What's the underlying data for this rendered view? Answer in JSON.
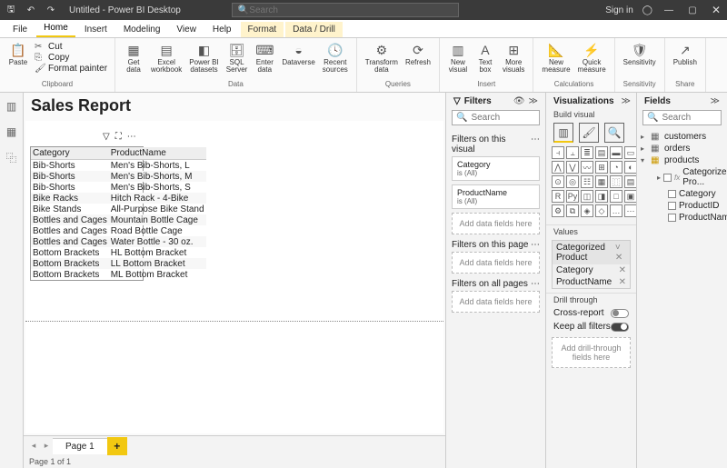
{
  "titlebar": {
    "title": "Untitled - Power BI Desktop",
    "search_placeholder": "Search",
    "signin": "Sign in"
  },
  "tabs": {
    "file": "File",
    "home": "Home",
    "insert": "Insert",
    "modeling": "Modeling",
    "view": "View",
    "help": "Help",
    "format": "Format",
    "data_drill": "Data / Drill"
  },
  "ribbon": {
    "clipboard": {
      "label": "Clipboard",
      "paste": "Paste",
      "cut": "Cut",
      "copy": "Copy",
      "format_painter": "Format painter"
    },
    "data": {
      "label": "Data",
      "get_data": "Get\ndata",
      "excel": "Excel\nworkbook",
      "pbi": "Power BI\ndatasets",
      "sql": "SQL\nServer",
      "enter": "Enter\ndata",
      "dataverse": "Dataverse",
      "recent": "Recent\nsources"
    },
    "queries": {
      "label": "Queries",
      "transform": "Transform\ndata",
      "refresh": "Refresh"
    },
    "insert": {
      "label": "Insert",
      "new_visual": "New\nvisual",
      "text_box": "Text\nbox",
      "more": "More\nvisuals"
    },
    "calc": {
      "label": "Calculations",
      "new_measure": "New\nmeasure",
      "quick_measure": "Quick\nmeasure"
    },
    "sens": {
      "label": "Sensitivity",
      "btn": "Sensitivity"
    },
    "share": {
      "label": "Share",
      "publish": "Publish"
    }
  },
  "report": {
    "title": "Sales Report"
  },
  "table": {
    "col1": "Category",
    "col2": "ProductName",
    "rows": [
      [
        "Bib-Shorts",
        "Men's Bib-Shorts, L"
      ],
      [
        "Bib-Shorts",
        "Men's Bib-Shorts, M"
      ],
      [
        "Bib-Shorts",
        "Men's Bib-Shorts, S"
      ],
      [
        "Bike Racks",
        "Hitch Rack - 4-Bike"
      ],
      [
        "Bike Stands",
        "All-Purpose Bike Stand"
      ],
      [
        "Bottles and Cages",
        "Mountain Bottle Cage"
      ],
      [
        "Bottles and Cages",
        "Road Bottle Cage"
      ],
      [
        "Bottles and Cages",
        "Water Bottle - 30 oz."
      ],
      [
        "Bottom Brackets",
        "HL Bottom Bracket"
      ],
      [
        "Bottom Brackets",
        "LL Bottom Bracket"
      ],
      [
        "Bottom Brackets",
        "ML Bottom Bracket"
      ]
    ]
  },
  "page": {
    "tab": "Page 1",
    "status": "Page 1 of 1"
  },
  "filters": {
    "title": "Filters",
    "search": "Search",
    "on_visual": "Filters on this visual",
    "category": "Category",
    "cat_val": "is (All)",
    "product": "ProductName",
    "prod_val": "is (All)",
    "add_here": "Add data fields here",
    "on_page": "Filters on this page",
    "on_all": "Filters on all pages"
  },
  "viz": {
    "title": "Visualizations",
    "build": "Build visual",
    "values": "Values",
    "catprod": "Categorized Product",
    "category": "Category",
    "product": "ProductName",
    "drill": "Drill through",
    "cross": "Cross-report",
    "keep": "Keep all filters",
    "add_drill": "Add drill-through fields here"
  },
  "fields": {
    "title": "Fields",
    "search": "Search",
    "customers": "customers",
    "orders": "orders",
    "products": "products",
    "catprod": "Categorized Pro...",
    "category": "Category",
    "productid": "ProductID",
    "productname": "ProductName"
  }
}
